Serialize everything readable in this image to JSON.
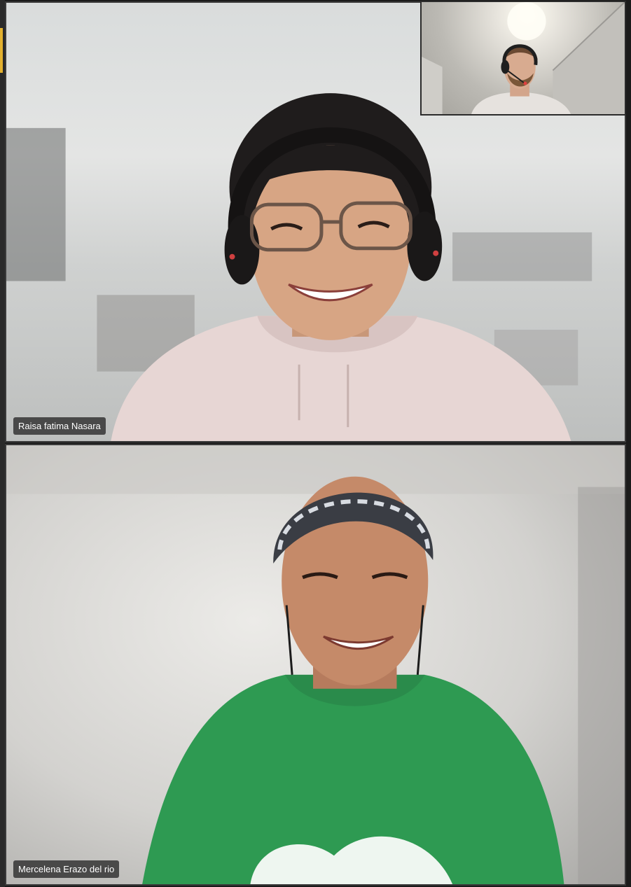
{
  "meeting": {
    "participants": [
      {
        "name": "Raisa fatima Nasara"
      },
      {
        "name": "Mercelena Erazo del rio"
      }
    ]
  },
  "colors": {
    "accent": "#e3b12f",
    "tile_border": "#3a3a3a",
    "name_tag_bg": "#282828"
  }
}
